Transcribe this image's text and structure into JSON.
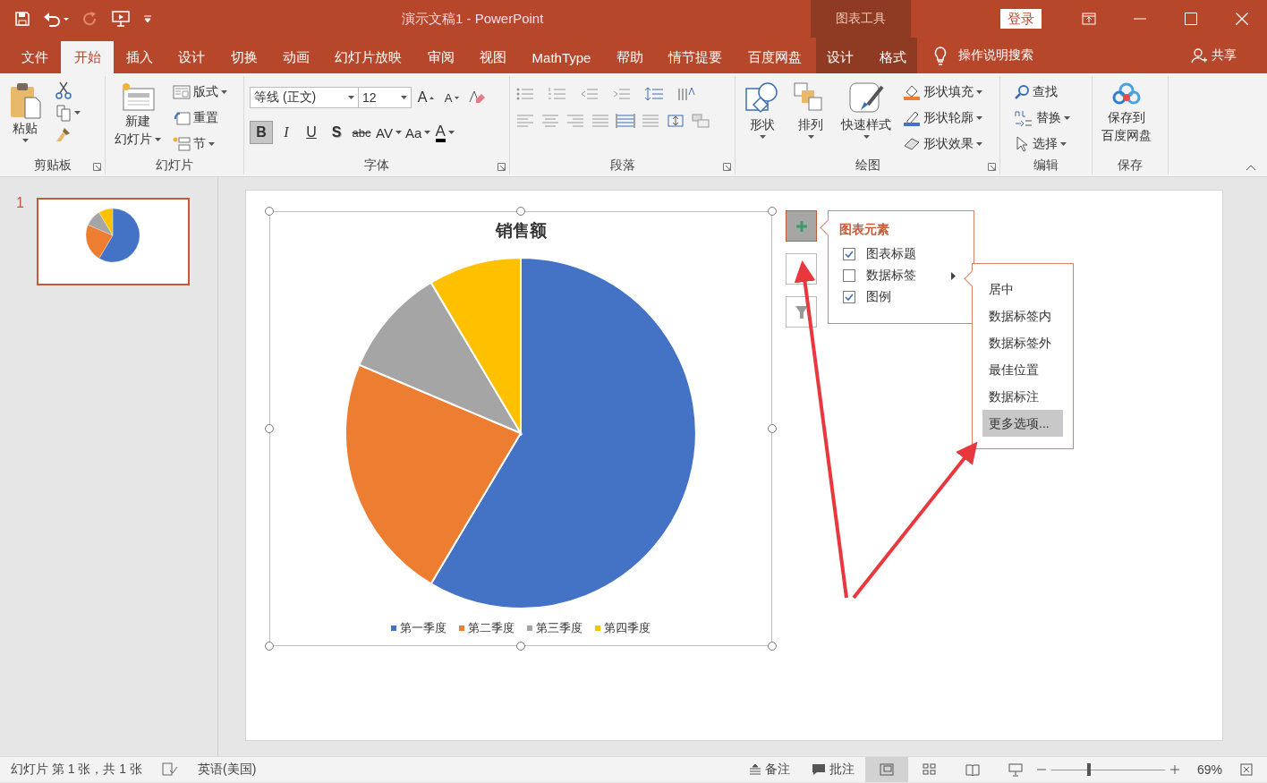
{
  "title_bar": {
    "title": "演示文稿1  -  PowerPoint",
    "context_group": "图表工具",
    "sign_in": "登录"
  },
  "tabs": [
    {
      "label": "文件",
      "selected": false,
      "kind": "main"
    },
    {
      "label": "开始",
      "selected": true,
      "kind": "main"
    },
    {
      "label": "插入",
      "selected": false,
      "kind": "main"
    },
    {
      "label": "设计",
      "selected": false,
      "kind": "main"
    },
    {
      "label": "切换",
      "selected": false,
      "kind": "main"
    },
    {
      "label": "动画",
      "selected": false,
      "kind": "main"
    },
    {
      "label": "幻灯片放映",
      "selected": false,
      "kind": "main"
    },
    {
      "label": "审阅",
      "selected": false,
      "kind": "main"
    },
    {
      "label": "视图",
      "selected": false,
      "kind": "main"
    },
    {
      "label": "MathType",
      "selected": false,
      "kind": "main"
    },
    {
      "label": "帮助",
      "selected": false,
      "kind": "main"
    },
    {
      "label": "情节提要",
      "selected": false,
      "kind": "main"
    },
    {
      "label": "百度网盘",
      "selected": false,
      "kind": "main"
    },
    {
      "label": "设计",
      "selected": false,
      "kind": "context"
    },
    {
      "label": "格式",
      "selected": false,
      "kind": "context"
    }
  ],
  "tell_me": "操作说明搜索",
  "share": "共享",
  "ribbon": {
    "groups": [
      {
        "kind": "clipboard",
        "label": "剪贴板",
        "paste": "粘贴"
      },
      {
        "kind": "slides",
        "label": "幻灯片",
        "new_slide": [
          "新建",
          "幻灯片"
        ],
        "buttons": [
          "版式",
          "重置",
          "节"
        ]
      },
      {
        "kind": "font",
        "label": "字体",
        "font_name": "等线 (正文)",
        "font_size": "12",
        "grow": "A",
        "shrink": "A",
        "font_color": "A",
        "styles": [
          {
            "label": "B",
            "kind": "bold",
            "selected": true
          },
          {
            "label": "I",
            "kind": "italic",
            "selected": false
          },
          {
            "label": "U",
            "kind": "underline",
            "selected": false
          },
          {
            "label": "S",
            "kind": "shadow",
            "selected": false
          },
          {
            "label": "abc",
            "kind": "strike",
            "selected": false
          },
          {
            "label": "AV",
            "kind": "spacing",
            "selected": false
          },
          {
            "label": "Aa",
            "kind": "case",
            "selected": false
          }
        ]
      },
      {
        "kind": "paragraph",
        "label": "段落"
      },
      {
        "kind": "drawing",
        "label": "绘图",
        "large": [
          "形状",
          "排列",
          "快速样式"
        ],
        "buttons": [
          "形状填充",
          "形状轮廓",
          "形状效果"
        ]
      },
      {
        "kind": "editing",
        "label": "编辑",
        "buttons": [
          "查找",
          "替换",
          "选择"
        ]
      },
      {
        "kind": "save",
        "label": "保存",
        "button": [
          "保存到",
          "百度网盘"
        ]
      }
    ]
  },
  "slides_pane": {
    "slides": [
      {
        "number": "1",
        "selected": true
      }
    ]
  },
  "chart": {
    "title": "销售额",
    "legend": [
      {
        "label": "第一季度",
        "color": "#4472c4"
      },
      {
        "label": "第二季度",
        "color": "#ed7d31"
      },
      {
        "label": "第三季度",
        "color": "#a5a5a5"
      },
      {
        "label": "第四季度",
        "color": "#ffc000"
      }
    ]
  },
  "chart_buttons": [
    {
      "kind": "elements",
      "selected": true
    },
    {
      "kind": "styles",
      "selected": false
    },
    {
      "kind": "filter",
      "selected": false
    }
  ],
  "chart_elements": {
    "title": "图表元素",
    "items": [
      {
        "label": "图表标题",
        "checked": true,
        "submenu": false
      },
      {
        "label": "数据标签",
        "checked": false,
        "submenu": true
      },
      {
        "label": "图例",
        "checked": true,
        "submenu": false
      }
    ]
  },
  "data_label_menu": {
    "items": [
      {
        "label": "居中",
        "selected": false
      },
      {
        "label": "数据标签内",
        "selected": false
      },
      {
        "label": "数据标签外",
        "selected": false
      },
      {
        "label": "最佳位置",
        "selected": false
      },
      {
        "label": "数据标注",
        "selected": false
      },
      {
        "label": "更多选项...",
        "selected": true
      }
    ]
  },
  "status_bar": {
    "slide_info": "幻灯片 第 1 张，共 1 张",
    "language": "英语(美国)",
    "notes": "备注",
    "comments": "批注",
    "views": [
      {
        "kind": "normal",
        "selected": true
      },
      {
        "kind": "sorter",
        "selected": false
      },
      {
        "kind": "reading",
        "selected": false
      },
      {
        "kind": "slideshow",
        "selected": false
      }
    ],
    "zoom": {
      "level": 0.33
    },
    "zoom_percent": "69%"
  }
}
